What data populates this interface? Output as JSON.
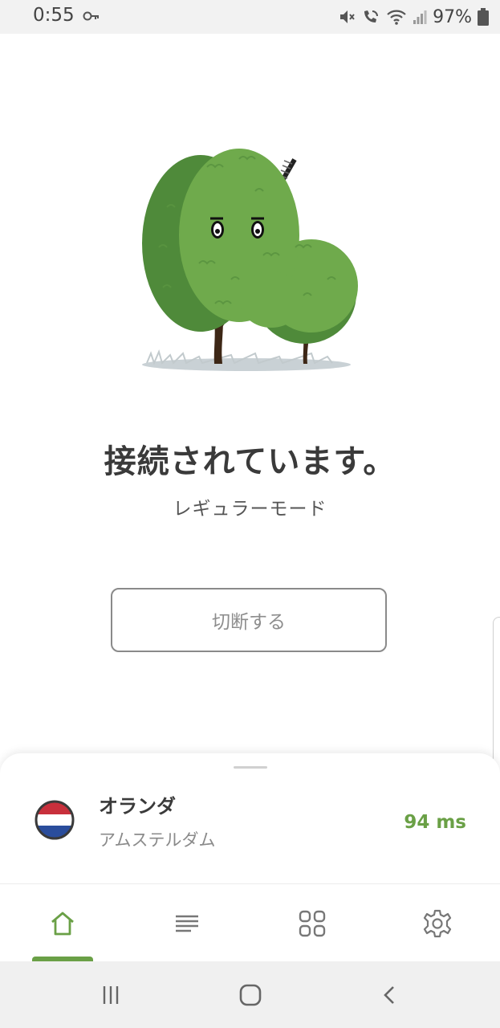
{
  "status_bar": {
    "time": "0:55",
    "battery": "97%"
  },
  "connection": {
    "status": "接続されています。",
    "mode": "レギュラーモード",
    "disconnect_label": "切断する"
  },
  "server": {
    "country": "オランダ",
    "city": "アムステルダム",
    "latency": "94 ms",
    "flag": "netherlands-flag"
  },
  "bottom_nav": {
    "items": [
      {
        "icon": "home-icon",
        "active": true
      },
      {
        "icon": "list-icon",
        "active": false
      },
      {
        "icon": "apps-grid-icon",
        "active": false
      },
      {
        "icon": "gear-icon",
        "active": false
      }
    ]
  },
  "colors": {
    "accent": "#6aa046",
    "tree_dark": "#4f8a3a",
    "tree_light": "#6faa4c"
  }
}
